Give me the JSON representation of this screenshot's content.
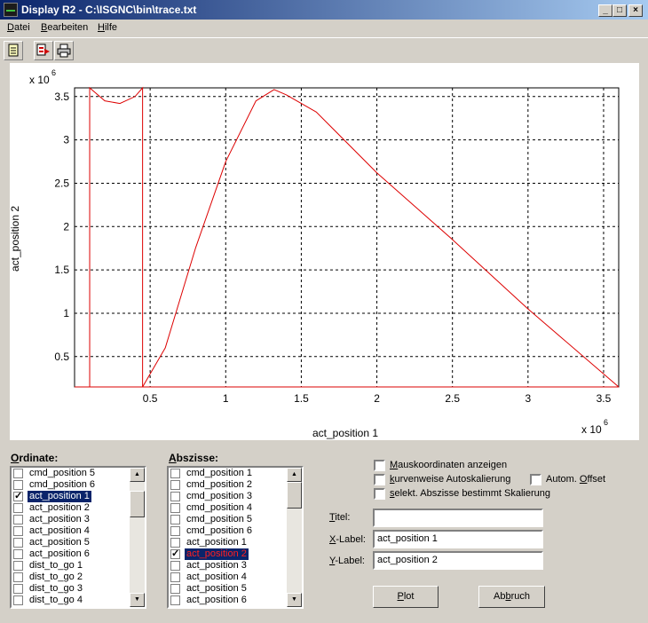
{
  "window": {
    "title": "Display R2 - C:\\ISGNC\\bin\\trace.txt"
  },
  "menu": [
    {
      "prefix": "",
      "u": "D",
      "rest": "atei"
    },
    {
      "prefix": "",
      "u": "B",
      "rest": "earbeiten"
    },
    {
      "prefix": "",
      "u": "H",
      "rest": "ilfe"
    }
  ],
  "toolbar": {
    "icons": [
      "new-document-icon",
      "export-icon",
      "print-icon"
    ]
  },
  "plot": {
    "y_exponent": "x 10",
    "y_exponent_power": "6",
    "x_exponent": "x 10",
    "x_exponent_power": "6"
  },
  "chart_data": {
    "type": "line",
    "xlabel": "act_position 1",
    "ylabel": "act_position 2",
    "xlim": [
      0,
      3.6
    ],
    "ylim": [
      0.15,
      3.6
    ],
    "x_ticks": [
      0.5,
      1,
      1.5,
      2,
      2.5,
      3,
      3.5
    ],
    "y_ticks": [
      0.5,
      1,
      1.5,
      2,
      2.5,
      3,
      3.5
    ],
    "x_tick_labels": [
      "0.5",
      "1",
      "1.5",
      "2",
      "2.5",
      "3",
      "3.5"
    ],
    "y_tick_labels": [
      "0.5",
      "1",
      "1.5",
      "2",
      "2.5",
      "3",
      "3.5"
    ],
    "grid": true,
    "line_color": "#dd0000",
    "series": [
      {
        "x": [
          0.0,
          3.6,
          0.1,
          0.1,
          0.2,
          0.3,
          0.4,
          0.45,
          0.45,
          0.45,
          0.6,
          0.8,
          1.0,
          1.2,
          1.32,
          1.4,
          1.6,
          2.0,
          2.5,
          3.0,
          3.6
        ],
        "y": [
          0.15,
          0.15,
          0.0,
          3.6,
          3.45,
          3.42,
          3.5,
          3.6,
          0.0,
          0.0,
          0.6,
          1.75,
          2.75,
          3.45,
          3.58,
          3.52,
          3.32,
          2.62,
          1.85,
          1.05,
          0.15
        ]
      }
    ]
  },
  "ordinate": {
    "label_u": "O",
    "label_rest": "rdinate:",
    "items": [
      {
        "label": "cmd_position 5",
        "checked": false,
        "selected": false
      },
      {
        "label": "cmd_position 6",
        "checked": false,
        "selected": false
      },
      {
        "label": "act_position 1",
        "checked": true,
        "selected": true
      },
      {
        "label": "act_position 2",
        "checked": false,
        "selected": false
      },
      {
        "label": "act_position 3",
        "checked": false,
        "selected": false
      },
      {
        "label": "act_position 4",
        "checked": false,
        "selected": false
      },
      {
        "label": "act_position 5",
        "checked": false,
        "selected": false
      },
      {
        "label": "act_position 6",
        "checked": false,
        "selected": false
      },
      {
        "label": "dist_to_go 1",
        "checked": false,
        "selected": false
      },
      {
        "label": "dist_to_go 2",
        "checked": false,
        "selected": false
      },
      {
        "label": "dist_to_go 3",
        "checked": false,
        "selected": false
      },
      {
        "label": "dist_to_go 4",
        "checked": false,
        "selected": false
      }
    ]
  },
  "abscissa": {
    "label_u": "A",
    "label_rest": "bszisse:",
    "items": [
      {
        "label": "cmd_position 1",
        "checked": false,
        "selected": false
      },
      {
        "label": "cmd_position 2",
        "checked": false,
        "selected": false
      },
      {
        "label": "cmd_position 3",
        "checked": false,
        "selected": false
      },
      {
        "label": "cmd_position 4",
        "checked": false,
        "selected": false
      },
      {
        "label": "cmd_position 5",
        "checked": false,
        "selected": false
      },
      {
        "label": "cmd_position 6",
        "checked": false,
        "selected": false
      },
      {
        "label": "act_position 1",
        "checked": false,
        "selected": false
      },
      {
        "label": "act_position 2",
        "checked": true,
        "selected": true
      },
      {
        "label": "act_position 3",
        "checked": false,
        "selected": false
      },
      {
        "label": "act_position 4",
        "checked": false,
        "selected": false
      },
      {
        "label": "act_position 5",
        "checked": false,
        "selected": false
      },
      {
        "label": "act_position 6",
        "checked": false,
        "selected": false
      }
    ]
  },
  "options": {
    "mouse_coords": {
      "u": "M",
      "rest": "auskoordinaten anzeigen",
      "checked": false
    },
    "curve_autoscale": {
      "u": "k",
      "rest": "urvenweise Autoskalierung",
      "checked": false
    },
    "auto_offset": {
      "pre": "Autom. ",
      "u": "O",
      "rest": "ffset",
      "checked": false
    },
    "abscissa_scale": {
      "u": "s",
      "rest": "elekt. Abszisse bestimmt Skalierung",
      "checked": false
    }
  },
  "fields": {
    "title": {
      "u": "T",
      "rest": "itel:",
      "value": ""
    },
    "xlabel": {
      "u": "X",
      "rest": "-Label:",
      "value": "act_position 1"
    },
    "ylabel": {
      "u": "Y",
      "rest": "-Label:",
      "value": "act_position 2"
    }
  },
  "buttons": {
    "plot": {
      "u": "P",
      "rest": "lot"
    },
    "cancel": {
      "pre": "Ab",
      "u": "b",
      "rest": "ruch"
    }
  }
}
